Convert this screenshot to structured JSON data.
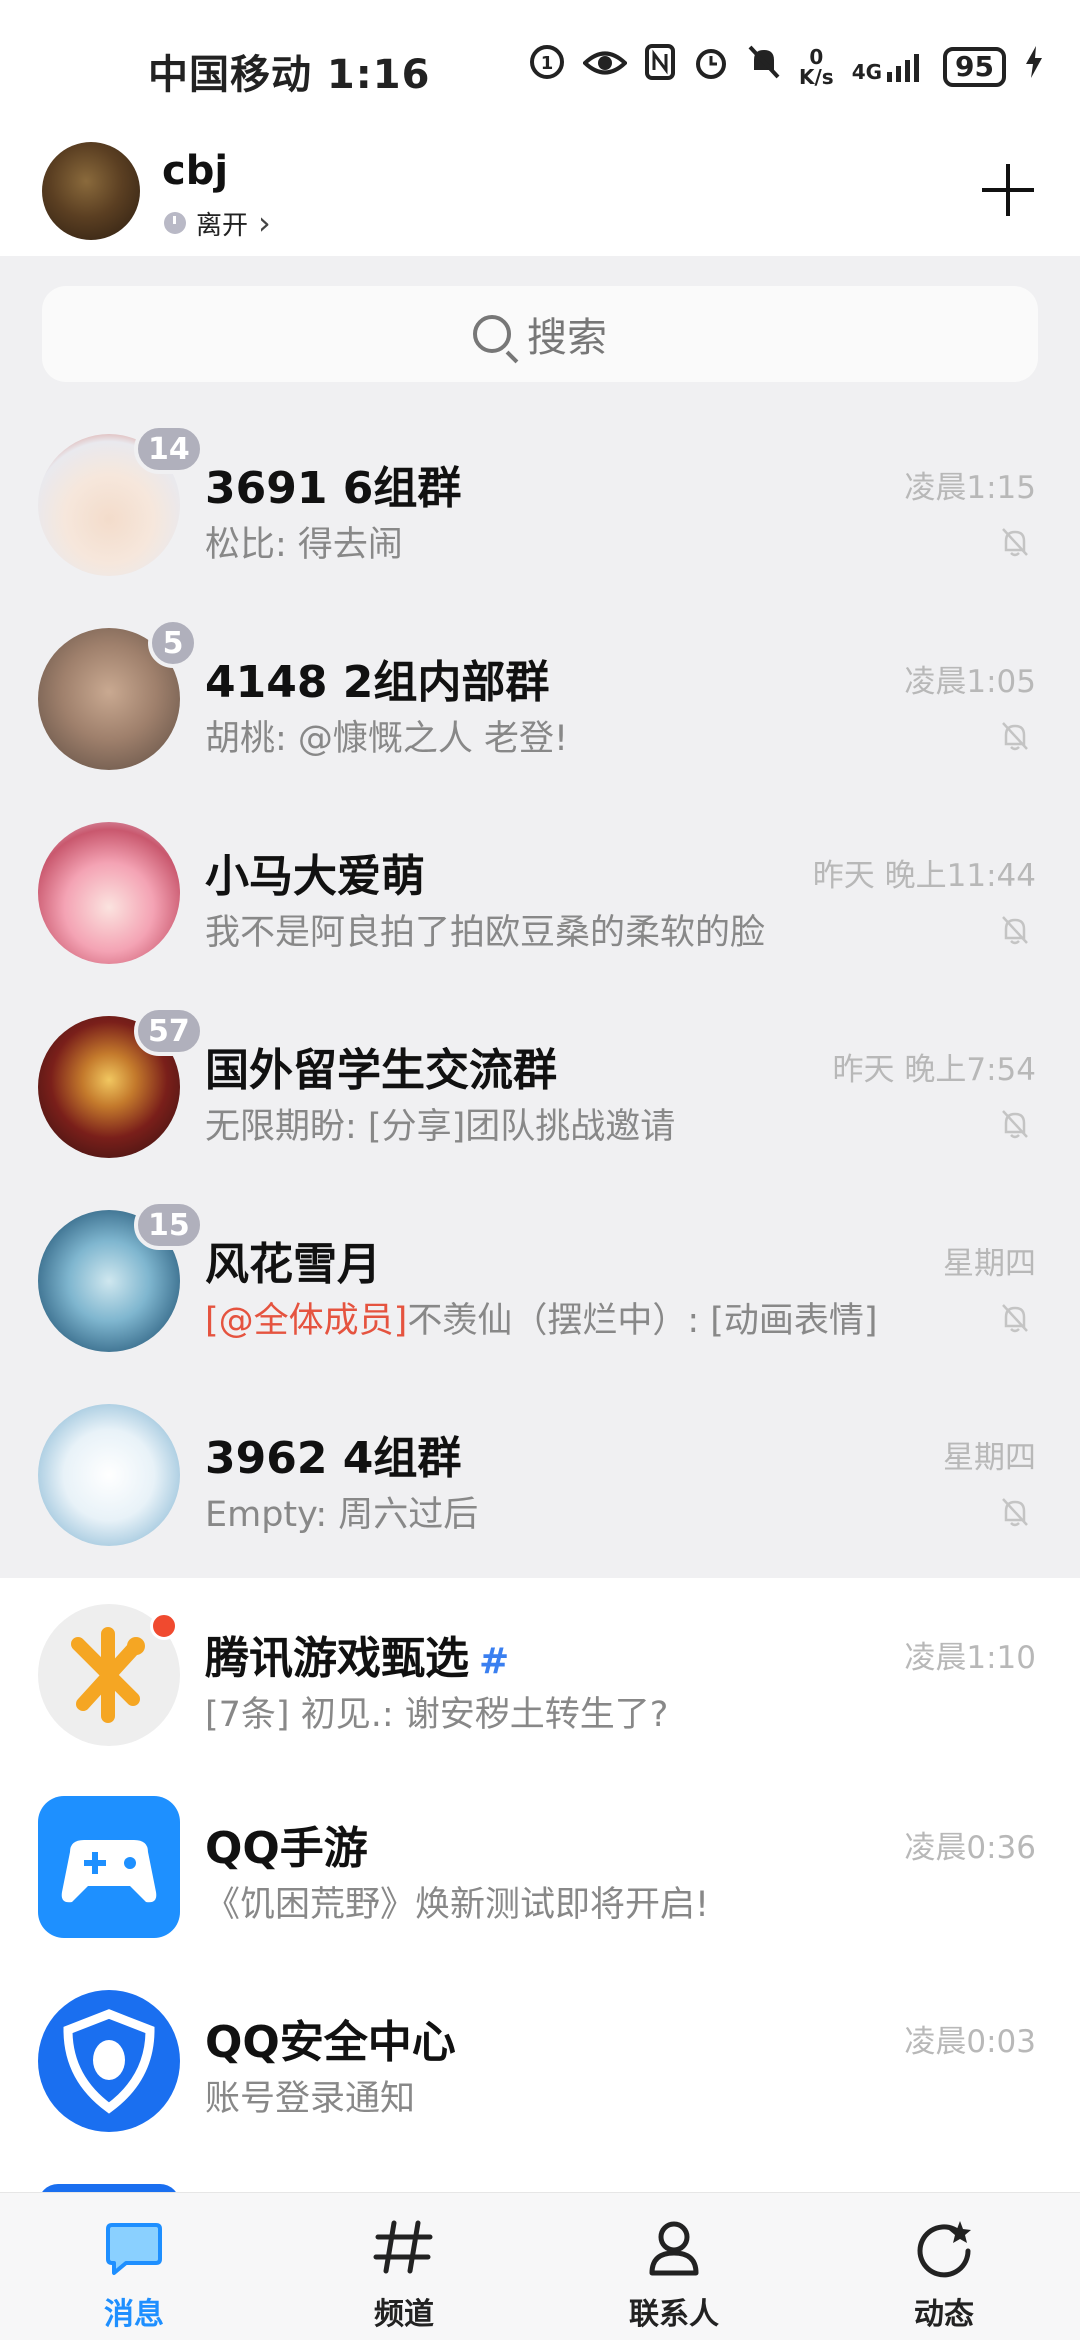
{
  "status_bar": {
    "carrier_time": "中国移动 1:16",
    "speed_value": "0",
    "speed_unit": "K/s",
    "network": "4G",
    "battery": "95"
  },
  "header": {
    "username": "cbj",
    "status": "离开",
    "status_chevron": "›"
  },
  "search": {
    "label": "搜索"
  },
  "chats": [
    {
      "title": "3691 6组群",
      "preview": "松比: 得去闹",
      "time": "凌晨1:15",
      "badge": "14",
      "muted": true
    },
    {
      "title": "4148   2组内部群",
      "preview": "胡桃: @慷慨之人 老登!",
      "time": "凌晨1:05",
      "badge": "5",
      "muted": true
    },
    {
      "title": "小马大爱萌",
      "preview": "我不是阿良拍了拍欧豆桑的柔软的脸",
      "time": "昨天 晚上11:44",
      "badge": "",
      "muted": true
    },
    {
      "title": "国外留学生交流群",
      "preview": "无限期盼: [分享]团队挑战邀请",
      "time": "昨天 晚上7:54",
      "badge": "57",
      "muted": true
    },
    {
      "title": "风花雪月",
      "preview_mention": "[@全体成员]",
      "preview": "不羡仙（摆烂中）: [动画表情]",
      "time": "星期四",
      "badge": "15",
      "muted": true
    },
    {
      "title": "3962  4组群",
      "preview": "Empty: 周六过后",
      "time": "星期四",
      "badge": "",
      "muted": true
    },
    {
      "title": "腾讯游戏甄选",
      "preview": "[7条] 初见.: 谢安秽土转生了?",
      "time": "凌晨1:10",
      "tag_icon": "#",
      "red_dot": true
    },
    {
      "title": "QQ手游",
      "preview": "《饥困荒野》焕新测试即将开启!",
      "time": "凌晨0:36"
    },
    {
      "title": "QQ安全中心",
      "preview": "账号登录通知",
      "time": "凌晨0:03"
    }
  ],
  "bottom_nav": [
    {
      "label": "消息",
      "icon": "message-bubble-icon",
      "active": true
    },
    {
      "label": "频道",
      "icon": "hashtag-icon",
      "active": false
    },
    {
      "label": "联系人",
      "icon": "person-icon",
      "active": false
    },
    {
      "label": "动态",
      "icon": "refresh-star-icon",
      "active": false
    }
  ],
  "colors": {
    "accent": "#1e8fff",
    "mention": "#e5533f",
    "badge": "#b0b0bc",
    "pinned_bg": "#f0f0f2"
  }
}
